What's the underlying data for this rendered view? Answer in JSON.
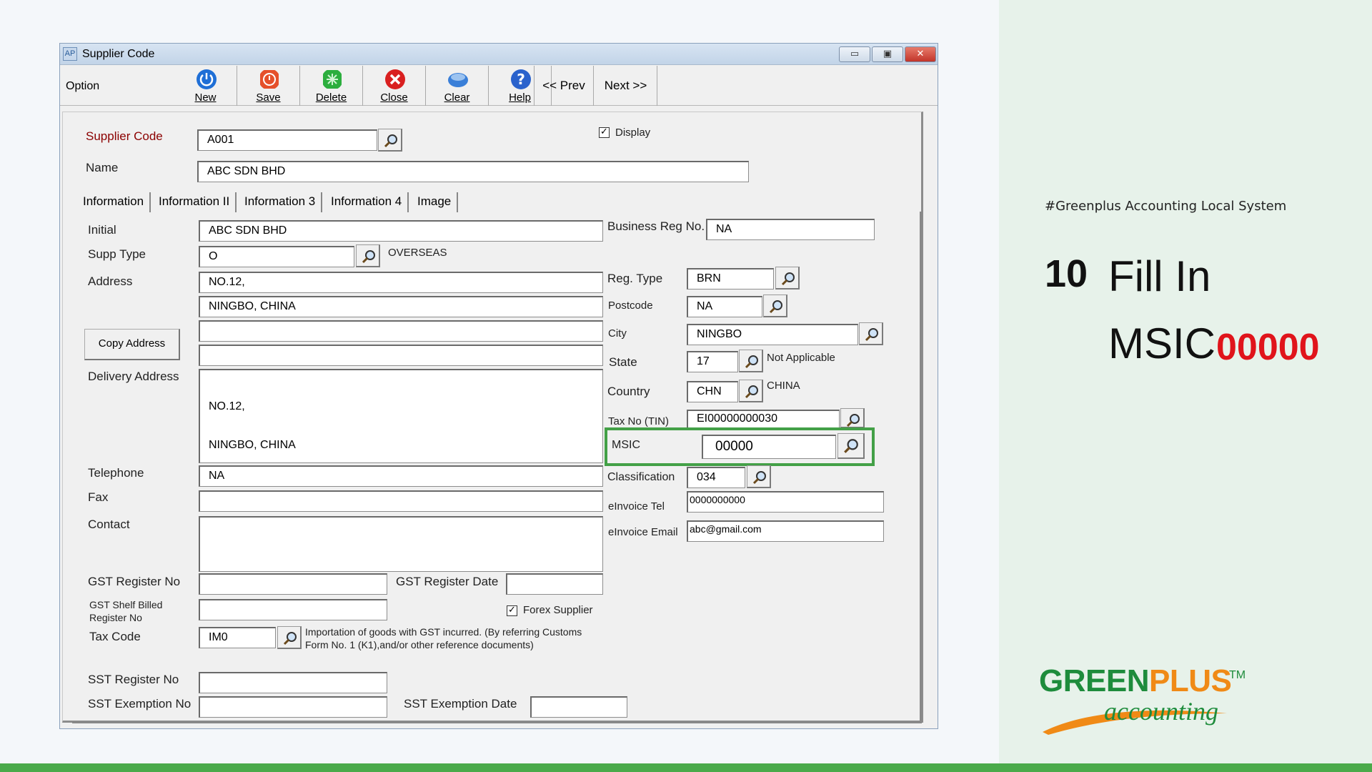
{
  "slide": {
    "hashtag": "#Greenplus Accounting Local System",
    "step_number": "10",
    "step_title_line1": "Fill In",
    "step_title_line2": "MSIC",
    "step_value": "00000",
    "logo_green": "GREEN",
    "logo_plus": "PLUS",
    "logo_tm": "TM",
    "logo_accounting": "accounting"
  },
  "window": {
    "icon_text": "AP",
    "title": "Supplier Code",
    "controls": {
      "minimize": "▭",
      "maximize": "▣",
      "close": "✕"
    }
  },
  "toolbar": {
    "option_label": "Option",
    "buttons": [
      {
        "label": "New",
        "icon": "power-icon",
        "color": "#1f6fd6"
      },
      {
        "label": "Save",
        "icon": "save-icon",
        "color": "#e5502b"
      },
      {
        "label": "Delete",
        "icon": "delete-icon",
        "color": "#2cae3e"
      },
      {
        "label": "Close",
        "icon": "close-circle-icon",
        "color": "#d92020"
      },
      {
        "label": "Clear",
        "icon": "clear-icon",
        "color": "#3a7fd8"
      },
      {
        "label": "Help",
        "icon": "help-icon",
        "color": "#2a62cc"
      }
    ],
    "prev_label": "<<  Prev",
    "next_label": "Next  >>"
  },
  "header_fields": {
    "supplier_code_label": "Supplier Code",
    "supplier_code_value": "A001",
    "name_label": "Name",
    "name_value": "ABC SDN BHD",
    "display_label": "Display",
    "display_checked": "✓"
  },
  "tabs": [
    "Information",
    "Information II",
    "Information 3",
    "Information 4",
    "Image"
  ],
  "left": {
    "initial_label": "Initial",
    "initial_value": "ABC SDN BHD",
    "supp_type_label": "Supp Type",
    "supp_type_value": "O",
    "supp_type_desc": "OVERSEAS",
    "address_label": "Address",
    "address_lines": [
      "NO.12,",
      "NINGBO, CHINA",
      "",
      ""
    ],
    "copy_address_label": "Copy Address",
    "delivery_address_label": "Delivery Address",
    "delivery_address_line1": "NO.12,",
    "delivery_address_line2": "NINGBO, CHINA",
    "telephone_label": "Telephone",
    "telephone_value": "NA",
    "fax_label": "Fax",
    "fax_value": "",
    "contact_label": "Contact",
    "contact_value": "",
    "gst_register_no_label": "GST Register No",
    "gst_register_date_label": "GST Register Date",
    "gst_shelf_label_1": "GST Shelf Billed",
    "gst_shelf_label_2": "Register No",
    "forex_supplier_label": "Forex Supplier",
    "forex_checked": "✓",
    "tax_code_label": "Tax Code",
    "tax_code_value": "IM0",
    "tax_code_desc_1": "Importation of goods with GST incurred. (By referring Customs",
    "tax_code_desc_2": "Form No. 1 (K1),and/or other reference documents)",
    "sst_register_no_label": "SST Register No",
    "sst_exemption_no_label": "SST Exemption No",
    "sst_exemption_date_label": "SST Exemption Date"
  },
  "right": {
    "business_reg_label": "Business Reg No.",
    "business_reg_value": "NA",
    "reg_type_label": "Reg. Type",
    "reg_type_value": "BRN",
    "postcode_label": "Postcode",
    "postcode_value": "NA",
    "city_label": "City",
    "city_value": "NINGBO",
    "state_label": "State",
    "state_value": "17",
    "state_desc": "Not Applicable",
    "country_label": "Country",
    "country_value": "CHN",
    "country_desc": "CHINA",
    "tax_no_label": "Tax No (TIN)",
    "tax_no_value": "EI00000000030",
    "msic_label": "MSIC",
    "msic_value": "00000",
    "classification_label": "Classification",
    "classification_value": "034",
    "einvoice_tel_label": "eInvoice Tel",
    "einvoice_tel_value": "0000000000",
    "einvoice_email_label": "eInvoice Email",
    "einvoice_email_value": "abc@gmail.com"
  },
  "colors": {
    "highlight_box": "#43a047",
    "step_value": "#e0141b",
    "brand_green": "#1e8c3c",
    "brand_orange": "#f08a16",
    "supplier_code_label": "#8b0000"
  }
}
